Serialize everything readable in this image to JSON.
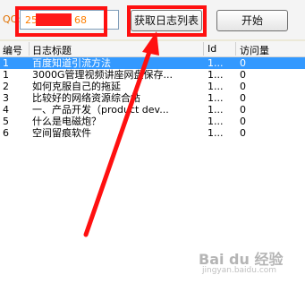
{
  "toolbar": {
    "qq_label": "QQ:",
    "qq_value_prefix": "25",
    "qq_value_suffix": "68",
    "fetch_button": "获取日志列表",
    "start_button": "开始"
  },
  "table": {
    "columns": [
      "编号",
      "日志标题",
      "Id",
      "访问量"
    ],
    "rows": [
      {
        "num": "1",
        "title": "百度知道引流方法",
        "id": "1...",
        "views": "0",
        "selected": true
      },
      {
        "num": "1",
        "title": "3000G管理视频讲座网盘保存...",
        "id": "1...",
        "views": "0"
      },
      {
        "num": "2",
        "title": "如何克服自己的拖延",
        "id": "1...",
        "views": "0"
      },
      {
        "num": "3",
        "title": "比较好的网络资源综合帖",
        "id": "1...",
        "views": "0"
      },
      {
        "num": "4",
        "title": "一、产品开发（product dev...",
        "id": "1...",
        "views": "0"
      },
      {
        "num": "5",
        "title": "什么是电磁炮？",
        "id": "1...",
        "views": "0"
      },
      {
        "num": "6",
        "title": "空间留痕软件",
        "id": "1...",
        "views": "0"
      }
    ]
  },
  "watermark": {
    "brand": "Bai du 经验",
    "url": "jingyan.baidu.com"
  },
  "colors": {
    "highlight": "#ff1010",
    "selection": "#3399ff",
    "qq_label": "#e07000"
  }
}
